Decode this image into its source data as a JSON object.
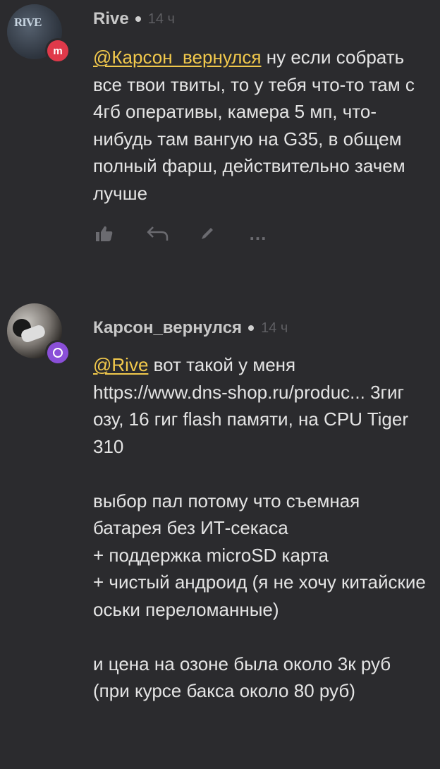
{
  "comments": [
    {
      "author": "Rive",
      "time": "14 ч",
      "avatar_text": "RIVE",
      "badge_icon": "m",
      "mention": "@Карсон_вернулся",
      "lines": [
        " ну если собрать все твои твиты, то у тебя что-то там с 4гб оперативы, камера 5 мп, что-нибудь там вангую на G35, в общем полный фарш, действительно зачем лучше"
      ],
      "actions": {
        "more": "..."
      }
    },
    {
      "author": "Карсон_вернулся",
      "time": "14 ч",
      "mention": "@Rive",
      "paragraphs": [
        " вот такой у меня https://www.dns-shop.ru/produc... 3гиг озу, 16 гиг flash памяти, на CPU Tiger 310",
        "выбор пал потому что съемная батарея без ИТ-секаса",
        "+ поддержка microSD карта",
        "+ чистый андроид (я не хочу китайские оськи переломанные)",
        "и цена на озоне была около 3к руб (при курсе бакса около 80 руб)"
      ]
    }
  ],
  "colors": {
    "background": "#2b2b2e",
    "mention": "#f2c94c",
    "badge_1": "#e0394a",
    "badge_2": "#8a4fd8",
    "muted": "#6b6b70"
  }
}
